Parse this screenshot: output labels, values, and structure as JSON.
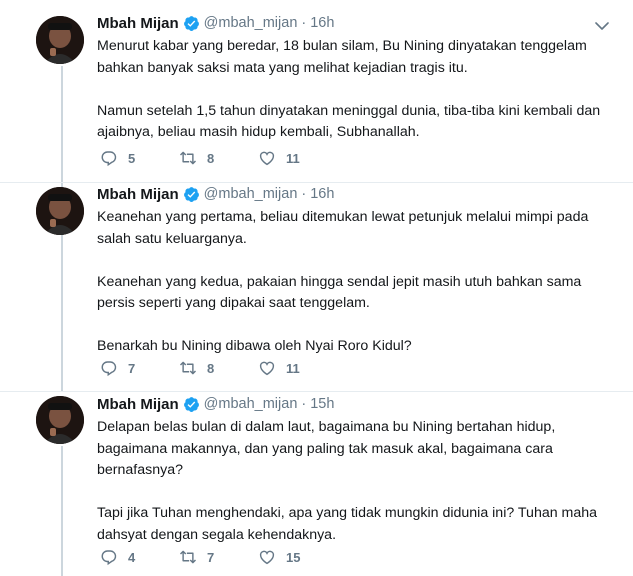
{
  "tweets": [
    {
      "name": "Mbah Mijan",
      "handle": "@mbah_mijan",
      "separator": "·",
      "time": "16h",
      "lines": [
        "Menurut kabar yang beredar, 18 bulan silam, Bu Nining dinyatakan tenggelam",
        "bahkan banyak saksi mata yang melihat kejadian tragis itu.",
        "",
        "Namun setelah 1,5 tahun dinyatakan meninggal dunia, tiba-tiba kini kembali dan",
        "ajaibnya, beliau masih hidup kembali, Subhanallah."
      ],
      "replies": "5",
      "retweets": "8",
      "likes": "11"
    },
    {
      "name": "Mbah Mijan",
      "handle": "@mbah_mijan",
      "separator": "·",
      "time": "16h",
      "lines": [
        "Keanehan yang pertama, beliau ditemukan lewat petunjuk melalui mimpi pada",
        "salah satu keluarganya.",
        "",
        "Keanehan yang kedua, pakaian hingga sendal jepit masih utuh bahkan sama",
        "persis seperti yang dipakai saat tenggelam.",
        "",
        "Benarkah bu Nining dibawa oleh Nyai Roro Kidul?"
      ],
      "replies": "7",
      "retweets": "8",
      "likes": "11"
    },
    {
      "name": "Mbah Mijan",
      "handle": "@mbah_mijan",
      "separator": "·",
      "time": "15h",
      "lines": [
        "Delapan belas bulan di dalam laut, bagaimana bu Nining bertahan hidup,",
        "bagaimana makannya, dan yang paling tak masuk akal, bagaimana cara",
        "bernafasnya?",
        "",
        "Tapi jika Tuhan menghendaki, apa yang tidak mungkin didunia ini? Tuhan maha",
        "dahsyat dengan segala kehendaknya."
      ],
      "replies": "4",
      "retweets": "7",
      "likes": "15"
    }
  ],
  "icons": {
    "verified": "verified-badge-icon",
    "reply": "reply-icon",
    "retweet": "retweet-icon",
    "like": "heart-icon",
    "menu": "chevron-down-icon"
  },
  "colors": {
    "verified": "#1da1f2",
    "icon_gray": "#657786",
    "connector": "#ccd6dd"
  }
}
